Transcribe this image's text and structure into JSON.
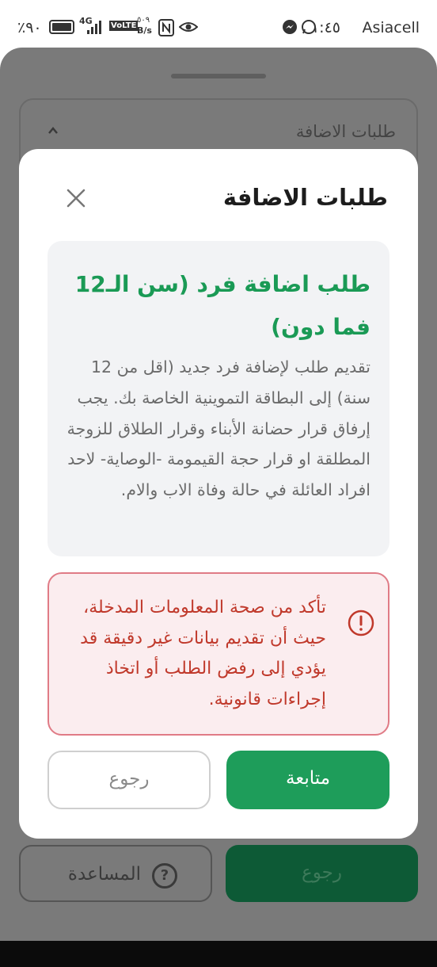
{
  "status_bar": {
    "carrier": "Asiacell",
    "time": "١:٤٥",
    "battery": "٪٩٠",
    "network": "4G",
    "volte": "VoLTE",
    "speed_value": "٥٠٩",
    "speed_unit": "B/s"
  },
  "background": {
    "card_title": "طلبات الاضافة",
    "help_label": "المساعدة",
    "help_icon": "?",
    "back_label": "رجوع"
  },
  "modal": {
    "title": "طلبات الاضافة",
    "info_heading": "طلب اضافة فرد (سن الـ12 فما دون)",
    "info_body": "تقديم طلب لإضافة فرد جديد (اقل من 12 سنة) إلى البطاقة التموينية الخاصة بك. يجب إرفاق قرار حضانة الأبناء وقرار الطلاق للزوجة المطلقة او قرار حجة القيمومة -الوصاية- لاحد افراد العائلة في حالة وفاة الاب والام.",
    "warning_text": "تأكد من صحة المعلومات المدخلة، حيث أن تقديم بيانات غير دقيقة قد يؤدي إلى رفض الطلب أو اتخاذ إجراءات قانونية.",
    "continue_label": "متابعة",
    "back_label": "رجوع"
  },
  "colors": {
    "accent_green": "#1e9d5a",
    "warning_red": "#c0392b",
    "warning_bg": "#fbedef"
  }
}
